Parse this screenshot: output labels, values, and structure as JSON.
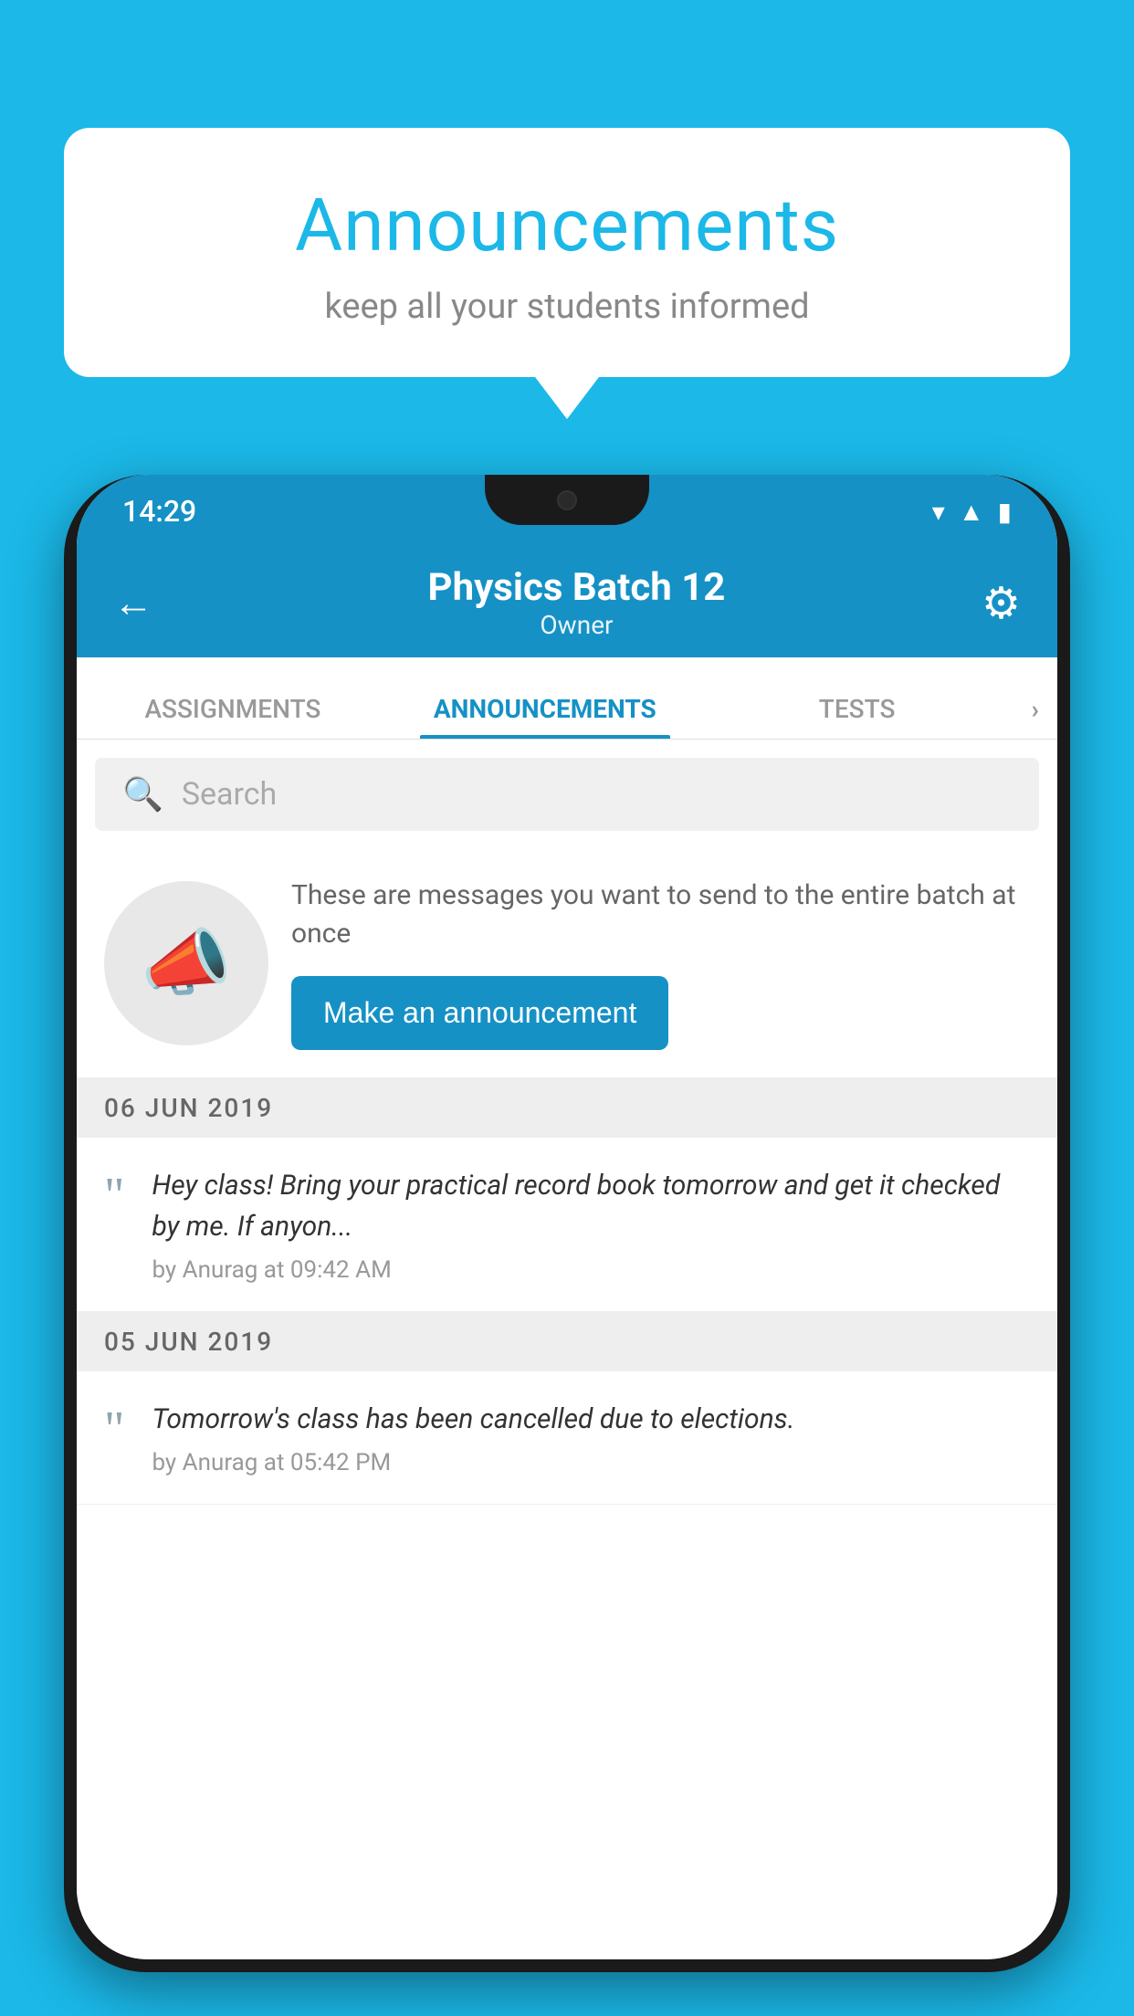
{
  "background_color": "#1BB8E8",
  "speech_bubble": {
    "title": "Announcements",
    "subtitle": "keep all your students informed"
  },
  "phone": {
    "status_bar": {
      "time": "14:29",
      "icons": [
        "wifi",
        "signal",
        "battery"
      ]
    },
    "header": {
      "title": "Physics Batch 12",
      "subtitle": "Owner",
      "back_label": "←",
      "gear_label": "⚙"
    },
    "tabs": [
      {
        "label": "ASSIGNMENTS",
        "active": false
      },
      {
        "label": "ANNOUNCEMENTS",
        "active": true
      },
      {
        "label": "TESTS",
        "active": false
      }
    ],
    "search": {
      "placeholder": "Search"
    },
    "promo": {
      "text": "These are messages you want to send to the entire batch at once",
      "button_label": "Make an announcement"
    },
    "announcements": [
      {
        "date": "06  JUN  2019",
        "text": "Hey class! Bring your practical record book tomorrow and get it checked by me. If anyon...",
        "meta": "by Anurag at 09:42 AM"
      },
      {
        "date": "05  JUN  2019",
        "text": "Tomorrow's class has been cancelled due to elections.",
        "meta": "by Anurag at 05:42 PM"
      }
    ]
  }
}
